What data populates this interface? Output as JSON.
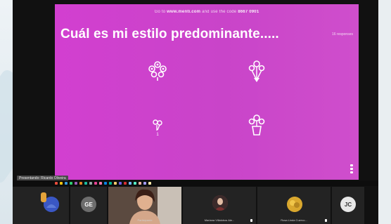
{
  "slide": {
    "instruction_prefix": "Go to",
    "instruction_site": "www.menti.com",
    "instruction_mid": "and use the code",
    "instruction_code": "8667 0901",
    "title": "Cuál es mi estilo predominante.....",
    "response_count": "16 responses",
    "options": [
      {
        "icon": "flower-cluster-icon",
        "count": ""
      },
      {
        "icon": "bouquet-icon",
        "count": ""
      },
      {
        "icon": "small-flower-icon",
        "count": "1"
      },
      {
        "icon": "flower-vase-icon",
        "count": ""
      }
    ]
  },
  "presenter_tag": "Presentando: Ricardo Oliveira",
  "participants": [
    {
      "initials": "",
      "name": "",
      "color": "#3a57c4",
      "muted": false,
      "kind": "avatar-image"
    },
    {
      "initials": "GE",
      "name": "",
      "color": "#6d6d6d",
      "muted": false,
      "kind": "initials"
    },
    {
      "initials": "",
      "name": "Participante",
      "color": "#3a2f2b",
      "muted": false,
      "kind": "video"
    },
    {
      "initials": "",
      "name": "Mariana Villalobos Ale...",
      "color": "#8b3e3e",
      "muted": true,
      "kind": "photo"
    },
    {
      "initials": "",
      "name": "Rosa Linda Cuervo...",
      "color": "#c79a2a",
      "muted": true,
      "kind": "photo"
    },
    {
      "initials": "JC",
      "name": "",
      "color": "#e8e8e8",
      "muted": false,
      "kind": "initials"
    }
  ],
  "colors": {
    "slide_bg": "#cc44cc",
    "taskbar_icons": [
      "#e74c3c",
      "#f1c40f",
      "#3498db",
      "#2ecc71",
      "#9b59b6",
      "#e67e22",
      "#1abc9c",
      "#95a5a6",
      "#e84393",
      "#fd79a8",
      "#0984e3",
      "#00b894",
      "#fdcb6e",
      "#6c5ce7",
      "#d63031",
      "#74b9ff",
      "#55efc4",
      "#fab1a0",
      "#a29bfe",
      "#ffeaa7"
    ]
  }
}
